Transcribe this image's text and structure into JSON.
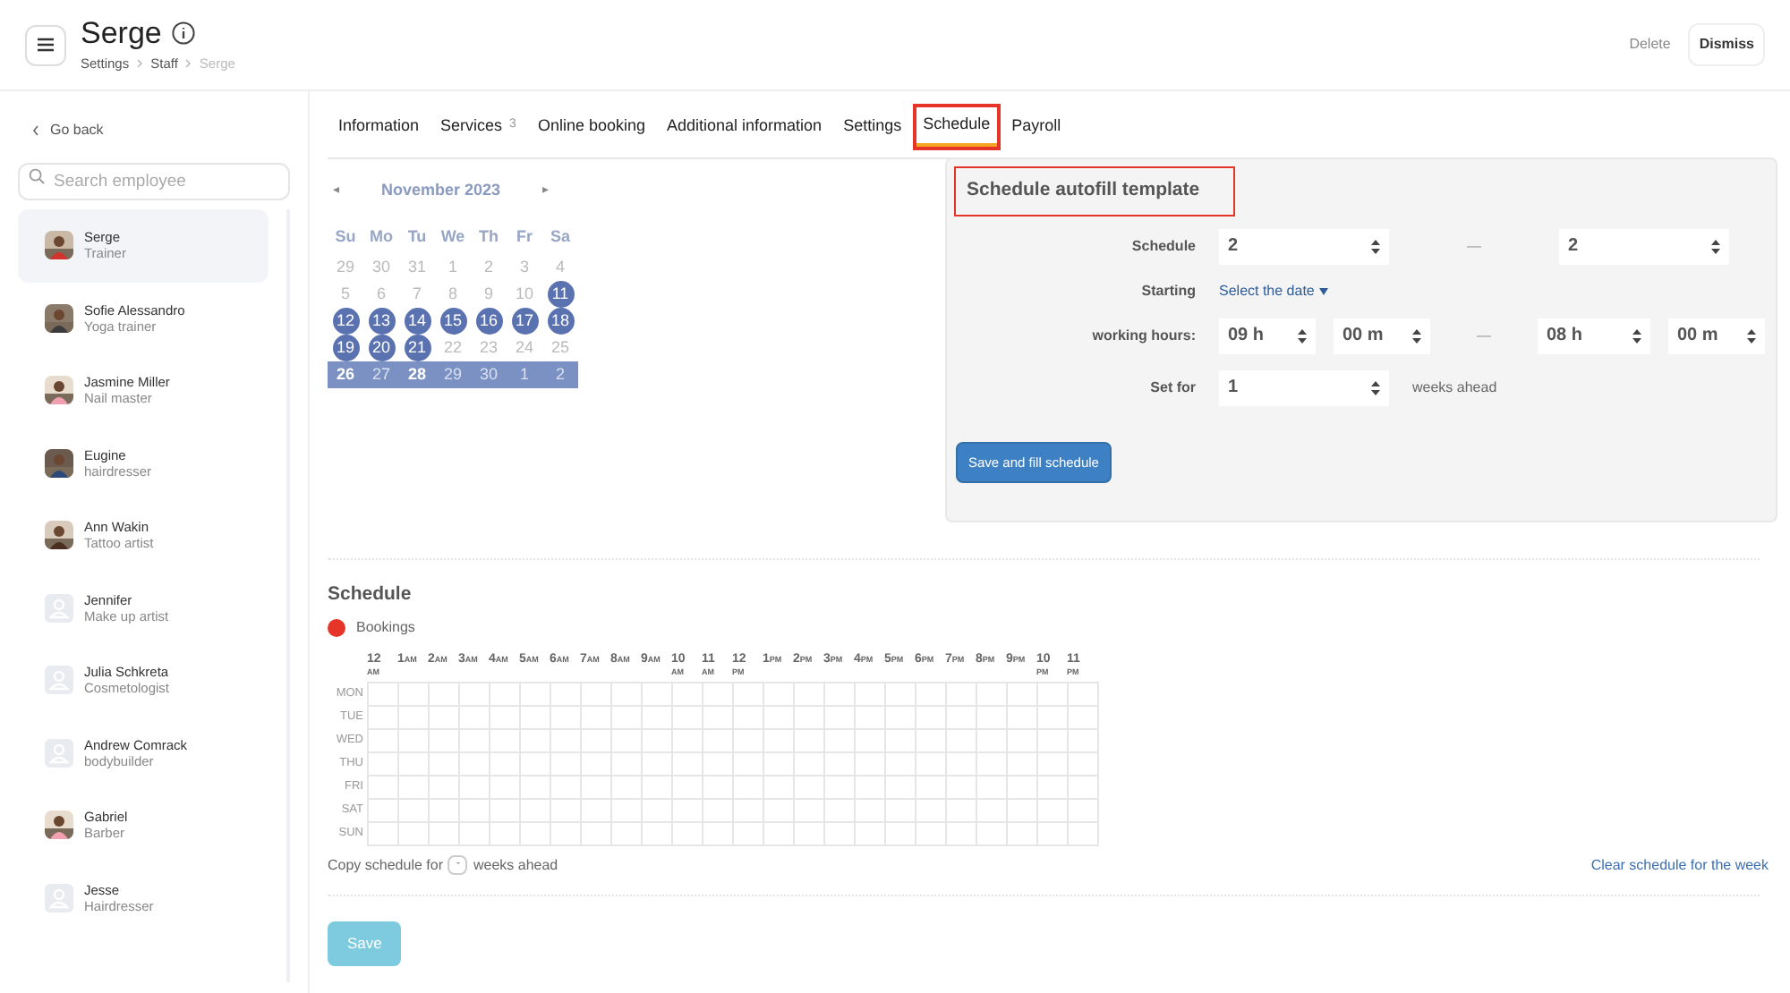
{
  "header": {
    "title": "Serge",
    "breadcrumbs": [
      {
        "label": "Settings",
        "current": false
      },
      {
        "label": "Staff",
        "current": false
      },
      {
        "label": "Serge",
        "current": true
      }
    ],
    "actions": {
      "delete": "Delete",
      "dismiss": "Dismiss"
    }
  },
  "sidebar": {
    "back": "Go back",
    "search": {
      "placeholder": "Search employee"
    },
    "employees": [
      {
        "name": "Serge",
        "role": "Trainer",
        "selected": true
      },
      {
        "name": "Sofie Alessandro",
        "role": "Yoga trainer",
        "selected": false
      },
      {
        "name": "Jasmine Miller",
        "role": "Nail master",
        "selected": false
      },
      {
        "name": "Eugine",
        "role": "hairdresser",
        "selected": false
      },
      {
        "name": "Ann Wakin",
        "role": "Tattoo artist",
        "selected": false
      },
      {
        "name": "Jennifer",
        "role": "Make up artist",
        "selected": false,
        "kind": "placeholder"
      },
      {
        "name": "Julia Schkreta",
        "role": "Cosmetologist",
        "selected": false,
        "kind": "placeholder"
      },
      {
        "name": "Andrew Comrack",
        "role": "bodybuilder",
        "selected": false,
        "kind": "placeholder"
      },
      {
        "name": "Gabriel",
        "role": "Barber",
        "selected": false
      },
      {
        "name": "Jesse",
        "role": "Hairdresser",
        "selected": false,
        "kind": "placeholder"
      }
    ]
  },
  "tabs": [
    {
      "label": "Information",
      "selected": false,
      "highlighted": false
    },
    {
      "label": "Services",
      "count": "3",
      "selected": false,
      "highlighted": false
    },
    {
      "label": "Online booking",
      "selected": false,
      "highlighted": false
    },
    {
      "label": "Additional information",
      "selected": false,
      "highlighted": false
    },
    {
      "label": "Settings",
      "selected": false,
      "highlighted": false
    },
    {
      "label": "Schedule",
      "selected": true,
      "highlighted": true
    },
    {
      "label": "Payroll",
      "selected": false,
      "highlighted": false
    }
  ],
  "calendar": {
    "prev": "◂",
    "month": "November 2023",
    "next": "▸",
    "weekdays": [
      "Su",
      "Mo",
      "Tu",
      "We",
      "Th",
      "Fr",
      "Sa"
    ],
    "weeks": [
      {
        "selected": false,
        "days": [
          {
            "day": "29",
            "marked": false,
            "dim": true
          },
          {
            "day": "30",
            "marked": false,
            "dim": true
          },
          {
            "day": "31",
            "marked": false,
            "dim": true
          },
          {
            "day": "1",
            "marked": false,
            "dim": true
          },
          {
            "day": "2",
            "marked": false,
            "dim": true
          },
          {
            "day": "3",
            "marked": false,
            "dim": true
          },
          {
            "day": "4",
            "marked": false,
            "dim": true
          }
        ]
      },
      {
        "selected": false,
        "days": [
          {
            "day": "5",
            "marked": false,
            "dim": true
          },
          {
            "day": "6",
            "marked": false,
            "dim": true
          },
          {
            "day": "7",
            "marked": false,
            "dim": true
          },
          {
            "day": "8",
            "marked": false,
            "dim": true
          },
          {
            "day": "9",
            "marked": false,
            "dim": true
          },
          {
            "day": "10",
            "marked": false,
            "dim": true
          },
          {
            "day": "11",
            "marked": true,
            "dim": false
          }
        ]
      },
      {
        "selected": false,
        "days": [
          {
            "day": "12",
            "marked": true,
            "dim": false
          },
          {
            "day": "13",
            "marked": true,
            "dim": false
          },
          {
            "day": "14",
            "marked": true,
            "dim": false
          },
          {
            "day": "15",
            "marked": true,
            "dim": false
          },
          {
            "day": "16",
            "marked": true,
            "dim": false
          },
          {
            "day": "17",
            "marked": true,
            "dim": false
          },
          {
            "day": "18",
            "marked": true,
            "dim": false
          }
        ]
      },
      {
        "selected": false,
        "days": [
          {
            "day": "19",
            "marked": true,
            "dim": false
          },
          {
            "day": "20",
            "marked": true,
            "dim": false
          },
          {
            "day": "21",
            "marked": true,
            "dim": false
          },
          {
            "day": "22",
            "marked": false,
            "dim": true
          },
          {
            "day": "23",
            "marked": false,
            "dim": true
          },
          {
            "day": "24",
            "marked": false,
            "dim": true
          },
          {
            "day": "25",
            "marked": false,
            "dim": true
          }
        ]
      },
      {
        "selected": true,
        "days": [
          {
            "day": "26",
            "marked": false,
            "dim": false
          },
          {
            "day": "27",
            "marked": false,
            "dim": true
          },
          {
            "day": "28",
            "marked": false,
            "dim": false
          },
          {
            "day": "29",
            "marked": false,
            "dim": true
          },
          {
            "day": "30",
            "marked": false,
            "dim": true
          },
          {
            "day": "1",
            "marked": false,
            "dim": true
          },
          {
            "day": "2",
            "marked": false,
            "dim": true
          }
        ]
      }
    ]
  },
  "autofill": {
    "title": "Schedule autofill template",
    "highlighted": true,
    "schedule": {
      "label": "Schedule",
      "from": "2",
      "dash": "—",
      "to": "2"
    },
    "starting": {
      "label": "Starting",
      "link": "Select the date"
    },
    "hours": {
      "label": "working hours:",
      "start_h": "09 h",
      "start_m": "00 m",
      "dash": "—",
      "end_h": "08 h",
      "end_m": "00 m"
    },
    "set_for": {
      "label": "Set for",
      "value": "1",
      "suffix": "weeks ahead"
    },
    "button": "Save and fill schedule"
  },
  "schedule": {
    "title": "Schedule",
    "legend": [
      {
        "label": "Bookings",
        "color": "#e53528"
      }
    ],
    "hours": [
      {
        "hour": "12",
        "period": "AM",
        "kind": "stacked"
      },
      {
        "hour": "1",
        "period": "AM",
        "kind": "inline"
      },
      {
        "hour": "2",
        "period": "AM",
        "kind": "inline"
      },
      {
        "hour": "3",
        "period": "AM",
        "kind": "inline"
      },
      {
        "hour": "4",
        "period": "AM",
        "kind": "inline"
      },
      {
        "hour": "5",
        "period": "AM",
        "kind": "inline"
      },
      {
        "hour": "6",
        "period": "AM",
        "kind": "inline"
      },
      {
        "hour": "7",
        "period": "AM",
        "kind": "inline"
      },
      {
        "hour": "8",
        "period": "AM",
        "kind": "inline"
      },
      {
        "hour": "9",
        "period": "AM",
        "kind": "inline"
      },
      {
        "hour": "10",
        "period": "AM",
        "kind": "stacked"
      },
      {
        "hour": "11",
        "period": "AM",
        "kind": "stacked"
      },
      {
        "hour": "12",
        "period": "PM",
        "kind": "stacked"
      },
      {
        "hour": "1",
        "period": "PM",
        "kind": "inline"
      },
      {
        "hour": "2",
        "period": "PM",
        "kind": "inline"
      },
      {
        "hour": "3",
        "period": "PM",
        "kind": "inline"
      },
      {
        "hour": "4",
        "period": "PM",
        "kind": "inline"
      },
      {
        "hour": "5",
        "period": "PM",
        "kind": "inline"
      },
      {
        "hour": "6",
        "period": "PM",
        "kind": "inline"
      },
      {
        "hour": "7",
        "period": "PM",
        "kind": "inline"
      },
      {
        "hour": "8",
        "period": "PM",
        "kind": "inline"
      },
      {
        "hour": "9",
        "period": "PM",
        "kind": "inline"
      },
      {
        "hour": "10",
        "period": "PM",
        "kind": "stacked"
      },
      {
        "hour": "11",
        "period": "PM",
        "kind": "stacked"
      }
    ],
    "days": [
      "MON",
      "TUE",
      "WED",
      "THU",
      "FRI",
      "SAT",
      "SUN"
    ],
    "copy_label": "Copy schedule for",
    "copy_value": "-",
    "copy_suffix": "weeks ahead",
    "clear": "Clear schedule for the week"
  },
  "save": "Save"
}
